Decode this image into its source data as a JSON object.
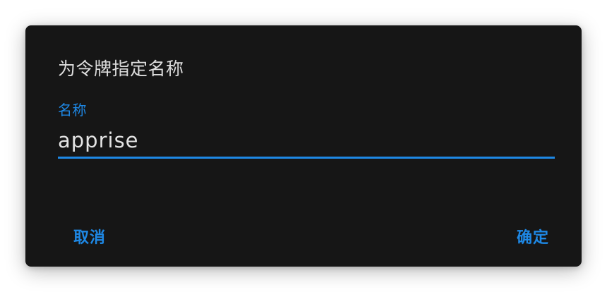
{
  "dialog": {
    "title": "为令牌指定名称",
    "field": {
      "label": "名称",
      "value": "apprise"
    },
    "actions": {
      "cancel_label": "取消",
      "confirm_label": "确定"
    }
  },
  "colors": {
    "dialog_background": "#161616",
    "accent": "#1e88e5",
    "title_text": "#dedede",
    "input_text": "#e4e4e4"
  }
}
